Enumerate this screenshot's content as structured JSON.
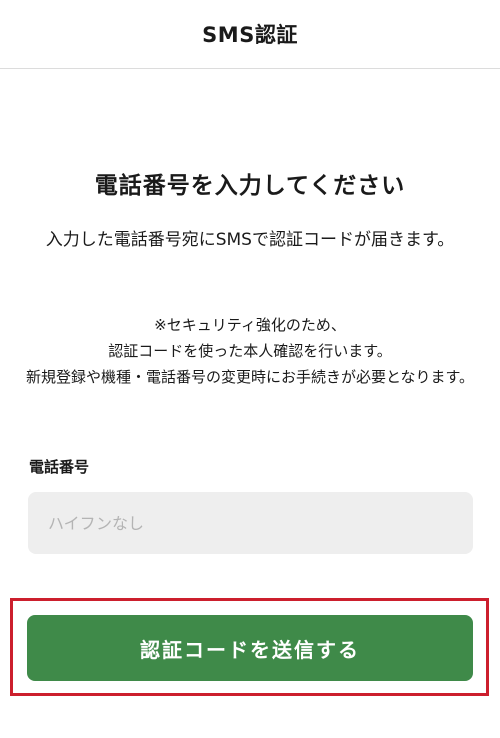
{
  "header": {
    "title": "SMS認証"
  },
  "main": {
    "heading": "電話番号を入力してください",
    "description": "入力した電話番号宛にSMSで認証コードが届きます。",
    "notice_lines": [
      "※セキュリティ強化のため、",
      "認証コードを使った本人確認を行います。",
      "新規登録や機種・電話番号の変更時にお手続きが必要となります。"
    ]
  },
  "form": {
    "phone_label": "電話番号",
    "phone_value": "",
    "phone_placeholder": "ハイフンなし",
    "submit_label": "認証コードを送信する"
  },
  "colors": {
    "button_green": "#3f8a49",
    "highlight_red": "#cc1f2d",
    "input_bg": "#eeeeee"
  }
}
